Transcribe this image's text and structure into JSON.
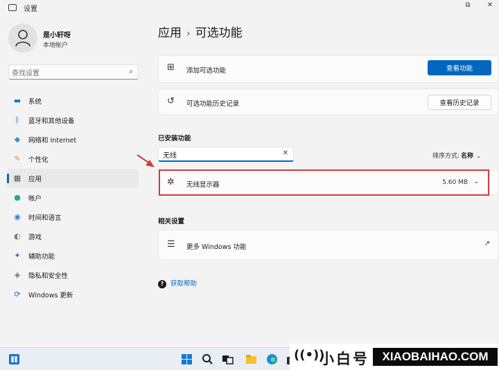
{
  "window": {
    "title": "设置",
    "controls": {
      "restore": "⧉",
      "close": "✕"
    }
  },
  "user": {
    "name": "是小轩呀",
    "account_type": "本地帐户"
  },
  "search": {
    "placeholder": "查找设置"
  },
  "sidebar": {
    "items": [
      {
        "label": "系统",
        "icon": "monitor-icon",
        "glyph": "▬",
        "color": "#0f7bd8"
      },
      {
        "label": "蓝牙和其他设备",
        "icon": "bluetooth-icon",
        "glyph": "ᛒ",
        "color": "#0067c0"
      },
      {
        "label": "网络和 Internet",
        "icon": "wifi-icon",
        "glyph": "◆",
        "color": "#3b8ed8"
      },
      {
        "label": "个性化",
        "icon": "brush-icon",
        "glyph": "✎",
        "color": "#e08a2e"
      },
      {
        "label": "应用",
        "icon": "apps-icon",
        "glyph": "▦",
        "color": "#555555",
        "active": true
      },
      {
        "label": "帐户",
        "icon": "account-icon",
        "glyph": "●",
        "color": "#2aa58a"
      },
      {
        "label": "时间和语言",
        "icon": "globe-icon",
        "glyph": "◉",
        "color": "#2f7fd1"
      },
      {
        "label": "游戏",
        "icon": "gamepad-icon",
        "glyph": "◐",
        "color": "#777777"
      },
      {
        "label": "辅助功能",
        "icon": "accessibility-icon",
        "glyph": "✦",
        "color": "#1b79d0"
      },
      {
        "label": "隐私和安全性",
        "icon": "shield-icon",
        "glyph": "◈",
        "color": "#6f7680"
      },
      {
        "label": "Windows 更新",
        "icon": "update-icon",
        "glyph": "⟳",
        "color": "#0e6fc7"
      }
    ]
  },
  "breadcrumb": {
    "parent": "应用",
    "separator": "›",
    "current": "可选功能"
  },
  "add_feature": {
    "label": "添加可选功能",
    "button": "查看功能"
  },
  "history": {
    "label": "可选功能历史记录",
    "button": "查看历史记录"
  },
  "installed": {
    "title": "已安装功能",
    "filter_value": "无线",
    "clear_icon": "✕",
    "sort_label": "排序方式:",
    "sort_value": "名称",
    "features": [
      {
        "name": "无线显示器",
        "size": "5.60 MB"
      }
    ]
  },
  "related": {
    "title": "相关设置",
    "more_windows_features": "更多 Windows 功能"
  },
  "help": {
    "label": "获取帮助"
  },
  "watermark": {
    "chinese": "小白号",
    "english": "XIAOBAIHAO.COM"
  },
  "colors": {
    "accent": "#0067c0",
    "highlight": "#d43a3a"
  }
}
